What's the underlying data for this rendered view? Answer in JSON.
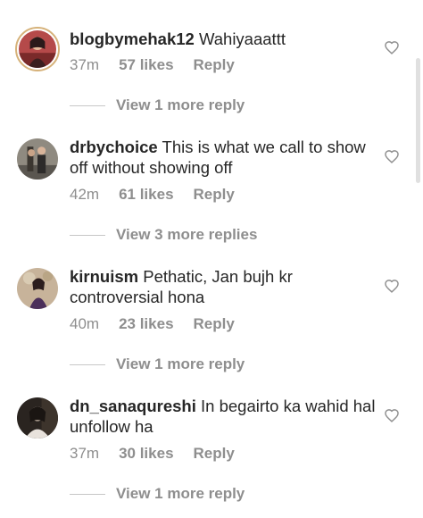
{
  "comments": [
    {
      "username": "blogbymehak12",
      "text": "Wahiyaaattt",
      "time": "37m",
      "likes": "57 likes",
      "reply_label": "Reply",
      "view_replies": "View 1 more reply",
      "heart_icon": "heart-outline-icon",
      "avatar_style": "ringed-story"
    },
    {
      "username": "drbychoice",
      "text": "This is what we call to show off without showing off",
      "time": "42m",
      "likes": "61 likes",
      "reply_label": "Reply",
      "view_replies": "View 3 more replies",
      "heart_icon": "heart-outline-icon"
    },
    {
      "username": "kirnuism",
      "text": "Pethatic, Jan bujh kr controversial hona",
      "time": "40m",
      "likes": "23 likes",
      "reply_label": "Reply",
      "view_replies": "View 1 more reply",
      "heart_icon": "heart-outline-icon"
    },
    {
      "username": "dn_sanaqureshi",
      "text": "In begairto ka wahid hal unfollow ha",
      "time": "37m",
      "likes": "30 likes",
      "reply_label": "Reply",
      "view_replies": "View 1 more reply",
      "heart_icon": "heart-outline-icon"
    }
  ],
  "colors": {
    "text": "#262626",
    "secondary": "#8e8e8e",
    "divider": "#c7c7c7",
    "story_ring": "#d6b27a"
  }
}
